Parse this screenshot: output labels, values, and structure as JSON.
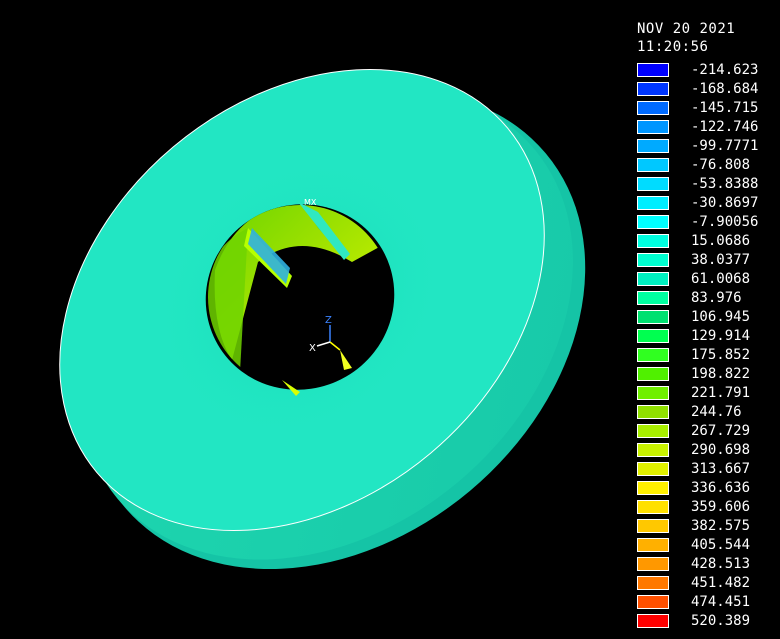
{
  "header": {
    "date": "NOV 20 2021",
    "time": "11:20:56"
  },
  "model": {
    "max_marker": "MX",
    "triad_z": "Z",
    "triad_x": "X"
  },
  "legend": [
    {
      "value": "-214.623",
      "color": "#0000ff"
    },
    {
      "value": "-168.684",
      "color": "#0036ff"
    },
    {
      "value": "-145.715",
      "color": "#006aff"
    },
    {
      "value": "-122.746",
      "color": "#0096ff"
    },
    {
      "value": "-99.7771",
      "color": "#00aaff"
    },
    {
      "value": "-76.808",
      "color": "#00c8ff"
    },
    {
      "value": "-53.8388",
      "color": "#00dcff"
    },
    {
      "value": "-30.8697",
      "color": "#00eeff"
    },
    {
      "value": "-7.90056",
      "color": "#00ffff"
    },
    {
      "value": "15.0686",
      "color": "#00ffe0"
    },
    {
      "value": "38.0377",
      "color": "#00ffd0"
    },
    {
      "value": "61.0068",
      "color": "#00f0c0"
    },
    {
      "value": "83.976",
      "color": "#00ffa0"
    },
    {
      "value": "106.945",
      "color": "#00e070"
    },
    {
      "value": "129.914",
      "color": "#00ff50"
    },
    {
      "value": "175.852",
      "color": "#30ff20"
    },
    {
      "value": "198.822",
      "color": "#50f000"
    },
    {
      "value": "221.791",
      "color": "#70f000"
    },
    {
      "value": "244.76",
      "color": "#90e000"
    },
    {
      "value": "267.729",
      "color": "#a8ee00"
    },
    {
      "value": "290.698",
      "color": "#c8f000"
    },
    {
      "value": "313.667",
      "color": "#e0f000"
    },
    {
      "value": "336.636",
      "color": "#fff000"
    },
    {
      "value": "359.606",
      "color": "#ffe000"
    },
    {
      "value": "382.575",
      "color": "#ffc800"
    },
    {
      "value": "405.544",
      "color": "#ffb000"
    },
    {
      "value": "428.513",
      "color": "#ff9800"
    },
    {
      "value": "451.482",
      "color": "#ff7800"
    },
    {
      "value": "474.451",
      "color": "#ff5000"
    },
    {
      "value": "520.389",
      "color": "#ff0000"
    }
  ]
}
